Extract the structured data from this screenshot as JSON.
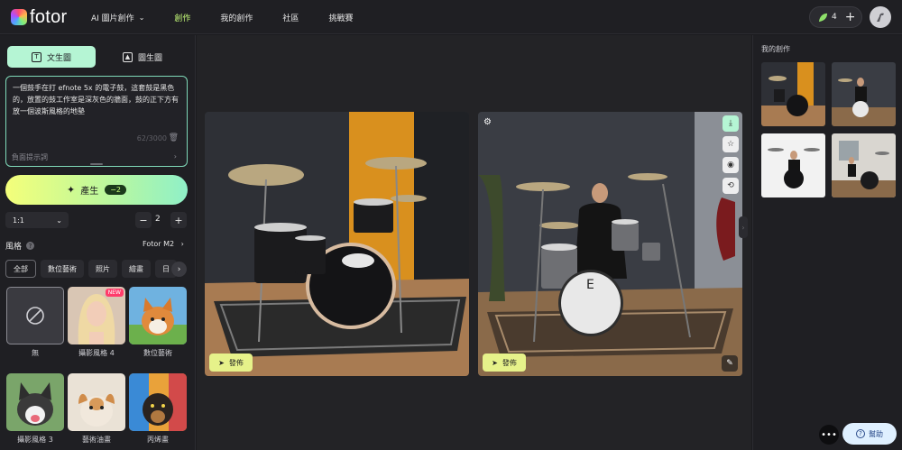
{
  "brand": {
    "name": "fotor"
  },
  "nav": {
    "items": [
      {
        "label": "AI 圖片創作",
        "has_dropdown": true
      },
      {
        "label": "創作",
        "active": true
      },
      {
        "label": "我的創作"
      },
      {
        "label": "社區"
      },
      {
        "label": "挑戰賽"
      }
    ]
  },
  "header": {
    "credits": "4",
    "add": "+"
  },
  "left": {
    "mode_text_to_image": "文生圖",
    "mode_image_to_image": "圖生圖",
    "prompt": "一個鼓手在打 efnote 5x 的電子鼓，這套鼓是黑色的，放置的鼓工作室是深灰色的牆面，鼓的正下方有放一個波斯風格的地墊",
    "prompt_count": "62/3000",
    "negative_prompt_label": "負面提示詞",
    "generate_label": "產生",
    "generate_cost": "−2",
    "aspect_ratio": "1:1",
    "quantity": "2",
    "style_label": "風格",
    "model": "Fotor M2",
    "style_filters": [
      "全部",
      "數位藝術",
      "照片",
      "繪畫",
      "日"
    ],
    "styles": [
      {
        "name": "無"
      },
      {
        "name": "攝影風格 4",
        "badge": "NEW"
      },
      {
        "name": "數位藝術"
      },
      {
        "name": "攝影風格 3"
      },
      {
        "name": "藝術油畫"
      },
      {
        "name": "丙烯畫"
      }
    ]
  },
  "results": {
    "publish_label": "發佈"
  },
  "right": {
    "title": "我的創作"
  },
  "help": {
    "label": "幫助"
  },
  "colors": {
    "accent": "#c8ff7a",
    "mint": "#b5f5d4",
    "publish": "#e6f28a"
  }
}
